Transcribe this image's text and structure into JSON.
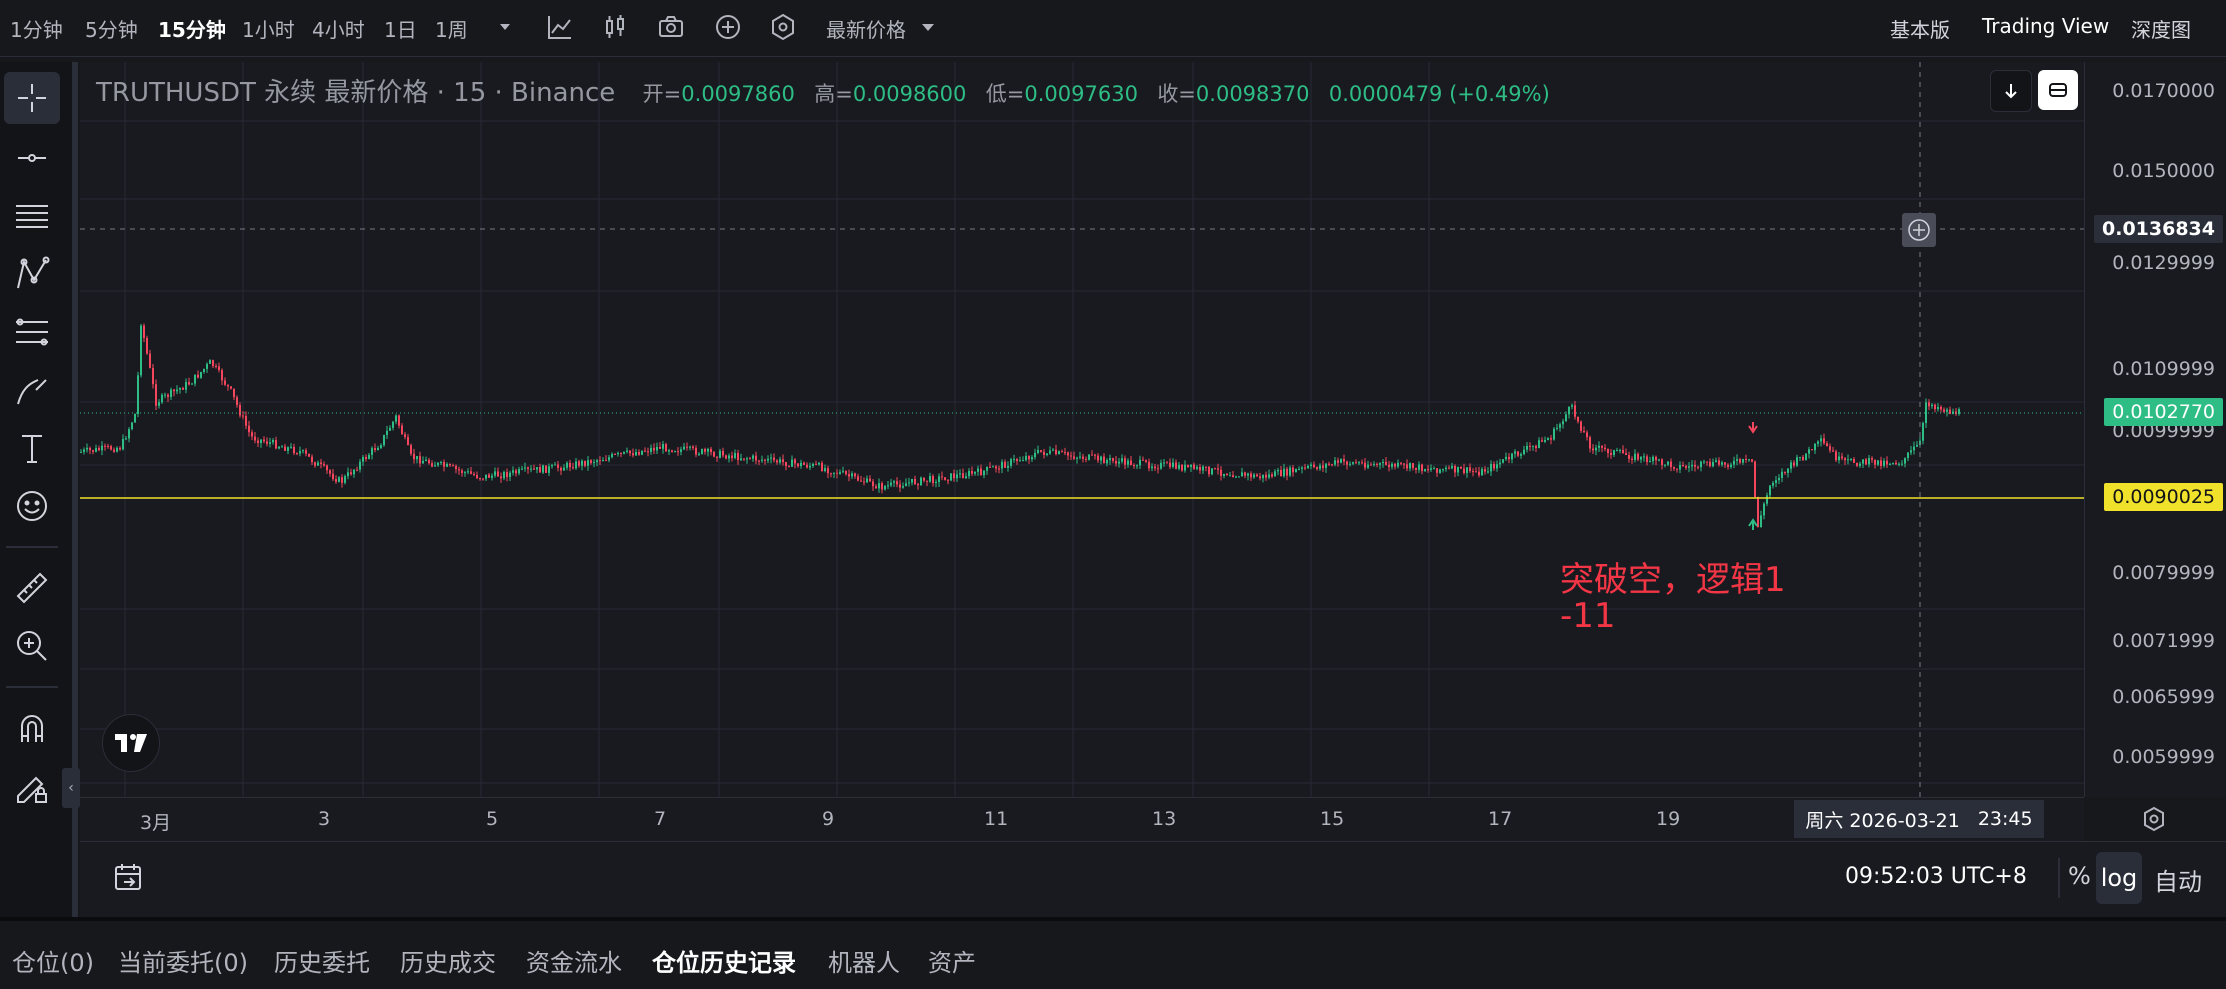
{
  "topbar": {
    "timeframes": [
      "1分钟",
      "5分钟",
      "15分钟",
      "1小时",
      "4小时",
      "1日",
      "1周"
    ],
    "price_type": "最新价格",
    "views": [
      "基本版",
      "Trading View",
      "深度图"
    ]
  },
  "legend": {
    "symbol": "TRUTHUSDT 永续 最新价格 · 15 · Binance",
    "open_label": "开=",
    "open": "0.0097860",
    "high_label": "高=",
    "high": "0.0098600",
    "low_label": "低=",
    "low": "0.0097630",
    "close_label": "收=",
    "close": "0.0098370",
    "change": "0.0000479 (+0.49%)"
  },
  "price_axis": {
    "labels": [
      "0.0170000",
      "0.0150000",
      "0.0129999",
      "0.0109999",
      "0.0099999",
      "0.0079999",
      "0.0071999",
      "0.0065999",
      "0.0059999"
    ],
    "crosshair_price": "0.0136834",
    "last_price": "0.0102770",
    "line_price": "0.0090025"
  },
  "time_axis": {
    "labels": [
      "3月",
      "3",
      "5",
      "7",
      "9",
      "11",
      "13",
      "15",
      "17",
      "19"
    ],
    "crosshair_date": "周六 2026-03-21",
    "crosshair_time": "23:45"
  },
  "annotation": {
    "line1": "突破空，逻辑1",
    "line2": "-11"
  },
  "bottom": {
    "clock": "09:52:03 UTC+8",
    "percent": "%",
    "log": "log",
    "auto": "自动"
  },
  "tabs": [
    "仓位(0)",
    "当前委托(0)",
    "历史委托",
    "历史成交",
    "资金流水",
    "仓位历史记录",
    "机器人",
    "资产"
  ],
  "colors": {
    "up": "#2ebd85",
    "down": "#f6465d",
    "level_line": "#f0e12a",
    "annotation": "#f23645"
  }
}
